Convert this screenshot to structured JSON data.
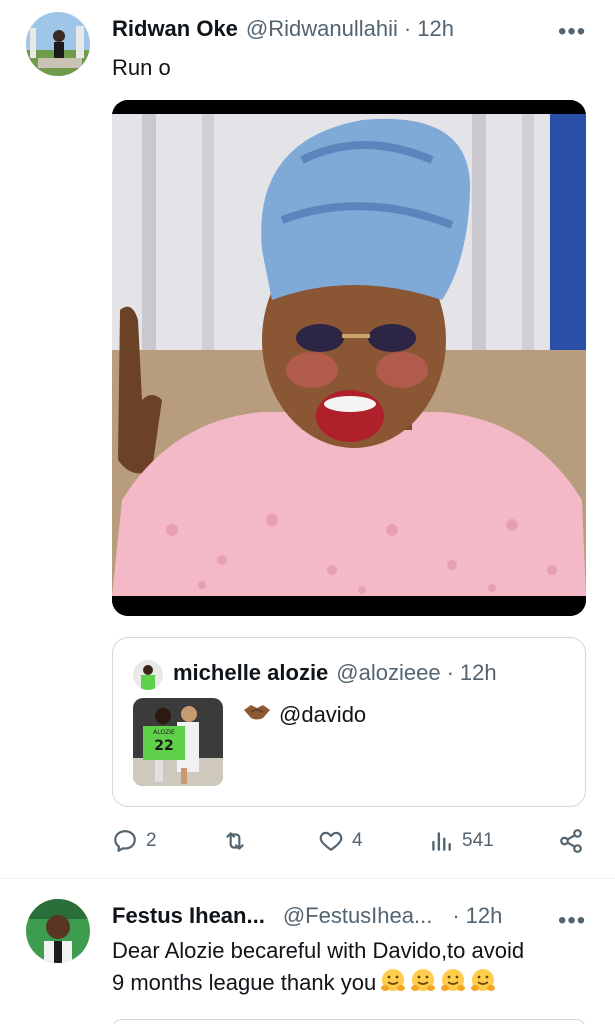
{
  "tweet1": {
    "name": "Ridwan Oke",
    "handle": "@Ridwanullahii",
    "dot": "·",
    "time": "12h",
    "more": "•••",
    "text": "Run o",
    "quote": {
      "name": "michelle alozie",
      "handle": "@alozieee",
      "dot": "·",
      "time": "12h",
      "text": "@davido",
      "jersey_number": "22",
      "jersey_name": "ALOZIE"
    },
    "actions": {
      "replies": "2",
      "retweets": "",
      "likes": "4",
      "views": "541"
    }
  },
  "tweet2": {
    "name": "Festus Ihean...",
    "handle": "@FestusIhea...",
    "dot": "·",
    "time": "12h",
    "more": "•••",
    "text_line1": "Dear Alozie becareful with Davido,to avoid",
    "text_line2": "9 months league thank you"
  },
  "colors": {
    "text": "#0f1419",
    "secondary": "#536471",
    "border": "#cfd9de",
    "shirt": "#f3b9c7",
    "headwrap": "#7fa9d6"
  },
  "icons": [
    "more-icon",
    "reply-icon",
    "retweet-icon",
    "like-icon",
    "views-icon",
    "share-icon",
    "handshake-icon",
    "hug-emoji-icon"
  ]
}
